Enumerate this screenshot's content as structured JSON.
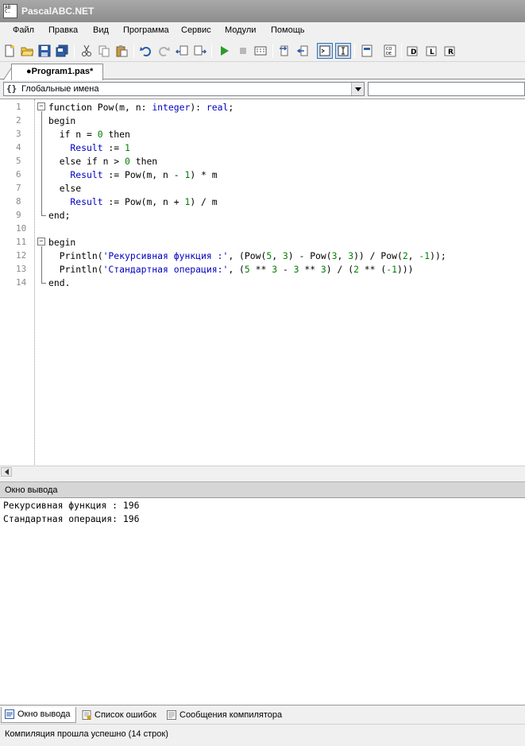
{
  "window": {
    "title": "PascalABC.NET"
  },
  "menu": [
    "Файл",
    "Правка",
    "Вид",
    "Программа",
    "Сервис",
    "Модули",
    "Помощь"
  ],
  "document_tab": {
    "label": "●Program1.pas*"
  },
  "scope": {
    "value": "Глобальные имена",
    "icon": "{}"
  },
  "editor": {
    "line_numbers": [
      "1",
      "2",
      "3",
      "4",
      "5",
      "6",
      "7",
      "8",
      "9",
      "10",
      "11",
      "12",
      "13",
      "14"
    ],
    "lines": [
      [
        {
          "t": "function ",
          "c": "kw"
        },
        {
          "t": "Pow(m, n: ",
          "c": "id"
        },
        {
          "t": "integer",
          "c": "tp"
        },
        {
          "t": "): ",
          "c": "id"
        },
        {
          "t": "real",
          "c": "tp"
        },
        {
          "t": ";",
          "c": "id"
        }
      ],
      [
        {
          "t": "begin",
          "c": "kw"
        }
      ],
      [
        {
          "t": "  if ",
          "c": "kw"
        },
        {
          "t": "n = ",
          "c": "id"
        },
        {
          "t": "0",
          "c": "nm"
        },
        {
          "t": " then",
          "c": "kw"
        }
      ],
      [
        {
          "t": "    Result",
          "c": "rs"
        },
        {
          "t": " := ",
          "c": "id"
        },
        {
          "t": "1",
          "c": "nm"
        }
      ],
      [
        {
          "t": "  else if ",
          "c": "kw"
        },
        {
          "t": "n > ",
          "c": "id"
        },
        {
          "t": "0",
          "c": "nm"
        },
        {
          "t": " then",
          "c": "kw"
        }
      ],
      [
        {
          "t": "    Result",
          "c": "rs"
        },
        {
          "t": " := Pow(m, n - ",
          "c": "id"
        },
        {
          "t": "1",
          "c": "nm"
        },
        {
          "t": ") * m",
          "c": "id"
        }
      ],
      [
        {
          "t": "  else",
          "c": "kw"
        }
      ],
      [
        {
          "t": "    Result",
          "c": "rs"
        },
        {
          "t": " := Pow(m, n + ",
          "c": "id"
        },
        {
          "t": "1",
          "c": "nm"
        },
        {
          "t": ") / m",
          "c": "id"
        }
      ],
      [
        {
          "t": "end;",
          "c": "kw"
        }
      ],
      [],
      [
        {
          "t": "begin",
          "c": "kw"
        }
      ],
      [
        {
          "t": "  Println(",
          "c": "id"
        },
        {
          "t": "'Рекурсивная функция :'",
          "c": "st"
        },
        {
          "t": ", (Pow(",
          "c": "id"
        },
        {
          "t": "5",
          "c": "nm"
        },
        {
          "t": ", ",
          "c": "id"
        },
        {
          "t": "3",
          "c": "nm"
        },
        {
          "t": ") - Pow(",
          "c": "id"
        },
        {
          "t": "3",
          "c": "nm"
        },
        {
          "t": ", ",
          "c": "id"
        },
        {
          "t": "3",
          "c": "nm"
        },
        {
          "t": ")) / Pow(",
          "c": "id"
        },
        {
          "t": "2",
          "c": "nm"
        },
        {
          "t": ", ",
          "c": "id"
        },
        {
          "t": "-1",
          "c": "nm"
        },
        {
          "t": "));",
          "c": "id"
        }
      ],
      [
        {
          "t": "  Println(",
          "c": "id"
        },
        {
          "t": "'Стандартная операция:'",
          "c": "st"
        },
        {
          "t": ", (",
          "c": "id"
        },
        {
          "t": "5",
          "c": "nm"
        },
        {
          "t": " ** ",
          "c": "id"
        },
        {
          "t": "3",
          "c": "nm"
        },
        {
          "t": " - ",
          "c": "id"
        },
        {
          "t": "3",
          "c": "nm"
        },
        {
          "t": " ** ",
          "c": "id"
        },
        {
          "t": "3",
          "c": "nm"
        },
        {
          "t": ") / (",
          "c": "id"
        },
        {
          "t": "2",
          "c": "nm"
        },
        {
          "t": " ** (",
          "c": "id"
        },
        {
          "t": "-1",
          "c": "nm"
        },
        {
          "t": ")))",
          "c": "id"
        }
      ],
      [
        {
          "t": "end.",
          "c": "kw"
        }
      ]
    ]
  },
  "output_panel": {
    "title": "Окно вывода",
    "lines": [
      "Рекурсивная функция : 196",
      "Стандартная операция: 196"
    ]
  },
  "bottom_tabs": [
    "Окно вывода",
    "Список ошибок",
    "Сообщения компилятора"
  ],
  "status": "Компиляция прошла успешно (14 строк)",
  "colors": {
    "keyword": "#000000",
    "type": "#0000c0",
    "number": "#008000",
    "string": "#0000c0"
  }
}
